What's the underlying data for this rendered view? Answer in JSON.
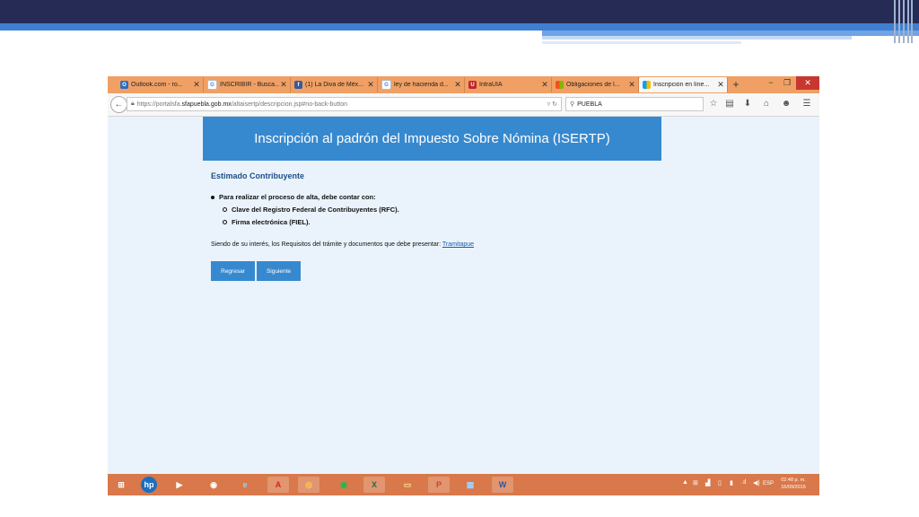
{
  "tabs": [
    {
      "title": "Outlook.com - ro...",
      "icon": "outlook-icon",
      "color": "#2a6dc0"
    },
    {
      "title": "INSCRIBIR - Busca...",
      "icon": "google-icon",
      "color": "#ffffff"
    },
    {
      "title": "(1) La Diva de Méx...",
      "icon": "facebook-icon",
      "color": "#3b5998"
    },
    {
      "title": "ley de hacienda d...",
      "icon": "google-icon",
      "color": "#ffffff"
    },
    {
      "title": "IntraUIA",
      "icon": "intrauia-icon",
      "color": "#c0262b"
    },
    {
      "title": "Obligaciones de l...",
      "icon": "windows-site-icon",
      "color": "#2a6dc0"
    },
    {
      "title": "Inscripción en líne...",
      "icon": "windows-site-icon",
      "color": "#2a6dc0"
    }
  ],
  "url": {
    "prefix": "https://portalsfa.",
    "host": "sfapuebla.gob.mx",
    "path": "/altaisertp/descripcion.jsp#no-back-button"
  },
  "search": {
    "value": "PUEBLA"
  },
  "page": {
    "banner": "Inscripción al padrón del Impuesto Sobre Nómina (ISERTP)",
    "greeting": "Estimado Contribuyente",
    "requirement_intro": "Para realizar el proceso de alta, debe contar con:",
    "requirements": [
      "Clave del Registro Federal de Contribuyentes (RFC).",
      "Firma electrónica (FIEL)."
    ],
    "info_text": "Siendo de su interés, los Requisitos del trámite y documentos que debe presentar:",
    "info_link": "Tramitapue",
    "btn_back": "Regresar",
    "btn_next": "Siguiente"
  },
  "taskbar": {
    "lang": "ESP",
    "time": "02:48 p. m.",
    "date": "16/09/2015",
    "apps": [
      "windows-start-icon",
      "hp-icon",
      "media-player-icon",
      "chrome-icon",
      "internet-explorer-icon",
      "acrobat-icon",
      "firefox-icon",
      "spotify-icon",
      "excel-icon",
      "file-explorer-icon",
      "powerpoint-icon",
      "network-app-icon",
      "word-icon"
    ]
  },
  "colors": {
    "accent": "#3789cf",
    "tabbar": "#f0a064",
    "taskbar": "#d9784a",
    "slide_dark": "#262b55"
  }
}
